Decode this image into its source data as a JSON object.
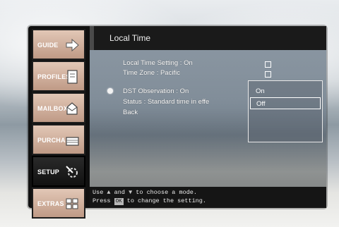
{
  "header": {
    "title": "Local Time"
  },
  "sidebar": {
    "tabs": [
      {
        "label": "GUIDE",
        "icon": "arrow-right-icon",
        "active": false
      },
      {
        "label": "PROFILES",
        "icon": "document-icon",
        "active": false
      },
      {
        "label": "MAILBOX",
        "icon": "envelope-icon",
        "active": false
      },
      {
        "label": "PURCHASES",
        "icon": "cart-icon",
        "active": false
      },
      {
        "label": "SETUP",
        "icon": "tools-icon",
        "active": true
      },
      {
        "label": "EXTRAS",
        "icon": "grid-icon",
        "active": false
      }
    ]
  },
  "menu": {
    "items": [
      "Local Time Setting : On",
      "Time Zone : Pacific",
      "DST Observation : On",
      "Status : Standard time in effe",
      "Back"
    ]
  },
  "dropdown": {
    "options": [
      "On",
      "Off"
    ],
    "selected": "Off"
  },
  "footer": {
    "line1_prefix": "Use",
    "line1_and": "and",
    "line1_suffix": "to choose a mode.",
    "line2_prefix": "Press",
    "line2_key": "OK",
    "line2_suffix": "to change the setting."
  }
}
